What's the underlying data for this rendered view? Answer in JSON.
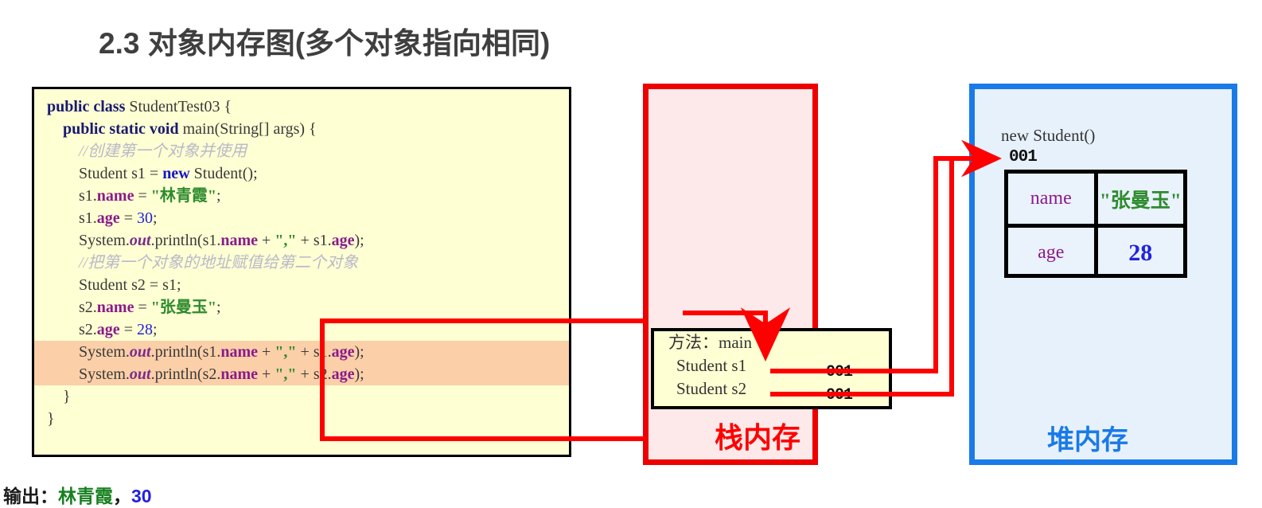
{
  "title": "2.3 对象内存图(多个对象指向相同)",
  "code": {
    "lines": [
      {
        "indent": 0,
        "highlight": false,
        "parts": [
          {
            "t": "public ",
            "c": "kw"
          },
          {
            "t": "class ",
            "c": "kw"
          },
          {
            "t": "StudentTest03 {",
            "c": "plain"
          }
        ]
      },
      {
        "indent": 1,
        "highlight": false,
        "parts": [
          {
            "t": "public ",
            "c": "kw"
          },
          {
            "t": "static ",
            "c": "kw"
          },
          {
            "t": "void ",
            "c": "kw"
          },
          {
            "t": "main(String[] args) {",
            "c": "plain"
          }
        ]
      },
      {
        "indent": 2,
        "highlight": false,
        "parts": [
          {
            "t": "//创建第一个对象并使用",
            "c": "cmt"
          }
        ]
      },
      {
        "indent": 2,
        "highlight": false,
        "parts": [
          {
            "t": "Student s1 = ",
            "c": "plain"
          },
          {
            "t": "new ",
            "c": "kw2"
          },
          {
            "t": "Student();",
            "c": "plain"
          }
        ]
      },
      {
        "indent": 2,
        "highlight": false,
        "parts": [
          {
            "t": "s1.",
            "c": "plain"
          },
          {
            "t": "name",
            "c": "fld"
          },
          {
            "t": " = ",
            "c": "plain"
          },
          {
            "t": "\"林青霞\"",
            "c": "str"
          },
          {
            "t": ";",
            "c": "plain"
          }
        ]
      },
      {
        "indent": 2,
        "highlight": false,
        "parts": [
          {
            "t": "s1.",
            "c": "plain"
          },
          {
            "t": "age",
            "c": "fld"
          },
          {
            "t": " = ",
            "c": "plain"
          },
          {
            "t": "30",
            "c": "num"
          },
          {
            "t": ";",
            "c": "plain"
          }
        ]
      },
      {
        "indent": 2,
        "highlight": false,
        "parts": [
          {
            "t": "System.",
            "c": "plain"
          },
          {
            "t": "out",
            "c": "ital"
          },
          {
            "t": ".println(s1.",
            "c": "plain"
          },
          {
            "t": "name",
            "c": "fld"
          },
          {
            "t": " + ",
            "c": "plain"
          },
          {
            "t": "\",\"",
            "c": "str"
          },
          {
            "t": " + s1.",
            "c": "plain"
          },
          {
            "t": "age",
            "c": "fld"
          },
          {
            "t": ");",
            "c": "plain"
          }
        ]
      },
      {
        "indent": 2,
        "highlight": false,
        "parts": [
          {
            "t": "//把第一个对象的地址赋值给第二个对象",
            "c": "cmt"
          }
        ]
      },
      {
        "indent": 2,
        "highlight": false,
        "parts": [
          {
            "t": "Student s2 = s1;",
            "c": "plain"
          }
        ]
      },
      {
        "indent": 2,
        "highlight": false,
        "parts": [
          {
            "t": "s2.",
            "c": "plain"
          },
          {
            "t": "name",
            "c": "fld"
          },
          {
            "t": " = ",
            "c": "plain"
          },
          {
            "t": "\"张曼玉\"",
            "c": "str"
          },
          {
            "t": ";",
            "c": "plain"
          }
        ]
      },
      {
        "indent": 2,
        "highlight": false,
        "parts": [
          {
            "t": "s2.",
            "c": "plain"
          },
          {
            "t": "age",
            "c": "fld"
          },
          {
            "t": " = ",
            "c": "plain"
          },
          {
            "t": "28",
            "c": "num"
          },
          {
            "t": ";",
            "c": "plain"
          }
        ]
      },
      {
        "indent": 2,
        "highlight": true,
        "parts": [
          {
            "t": "System.",
            "c": "plain"
          },
          {
            "t": "out",
            "c": "ital"
          },
          {
            "t": ".println(s1.",
            "c": "plain"
          },
          {
            "t": "name",
            "c": "fld"
          },
          {
            "t": " + ",
            "c": "plain"
          },
          {
            "t": "\",\"",
            "c": "str"
          },
          {
            "t": " + s1.",
            "c": "plain"
          },
          {
            "t": "age",
            "c": "fld"
          },
          {
            "t": ");",
            "c": "plain"
          }
        ]
      },
      {
        "indent": 2,
        "highlight": true,
        "parts": [
          {
            "t": "System.",
            "c": "plain"
          },
          {
            "t": "out",
            "c": "ital"
          },
          {
            "t": ".println(s2.",
            "c": "plain"
          },
          {
            "t": "name",
            "c": "fld"
          },
          {
            "t": " + ",
            "c": "plain"
          },
          {
            "t": "\",\"",
            "c": "str"
          },
          {
            "t": " + s2.",
            "c": "plain"
          },
          {
            "t": "age",
            "c": "fld"
          },
          {
            "t": ");",
            "c": "plain"
          }
        ]
      },
      {
        "indent": 1,
        "highlight": false,
        "parts": [
          {
            "t": "}",
            "c": "plain"
          }
        ]
      },
      {
        "indent": 0,
        "highlight": false,
        "parts": [
          {
            "t": "}",
            "c": "plain"
          }
        ]
      }
    ]
  },
  "stack": {
    "label": "栈内存",
    "frame": {
      "method_line": "方法：main",
      "vars": [
        {
          "decl": "Student s1",
          "value": "001"
        },
        {
          "decl": "Student s2",
          "value": "001"
        }
      ]
    }
  },
  "heap": {
    "label": "堆内存",
    "new_expression": "new Student()",
    "address": "001",
    "object_fields": [
      {
        "key": "name",
        "value": "\"张曼玉\"",
        "value_kind": "string"
      },
      {
        "key": "age",
        "value": "28",
        "value_kind": "number"
      }
    ]
  },
  "output": {
    "label": "输出：",
    "name": "林青霞",
    "separator": "，",
    "age": "30"
  },
  "colors": {
    "stack_border": "#ee0000",
    "stack_fill": "#fde9e9",
    "heap_border": "#1a7ae8",
    "heap_fill": "#e7f1fc",
    "code_fill": "#feffd3",
    "highlight_fill": "#fbcfa8",
    "connector": "#ff0000"
  }
}
